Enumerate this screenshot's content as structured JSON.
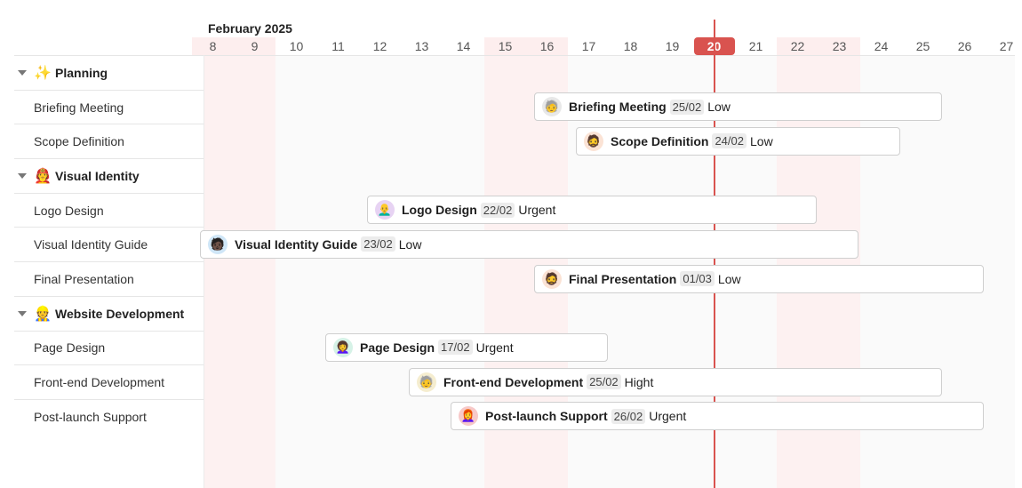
{
  "header": {
    "month": "February 2025"
  },
  "dates": [
    "8",
    "9",
    "10",
    "11",
    "12",
    "13",
    "14",
    "15",
    "16",
    "17",
    "18",
    "19",
    "20",
    "21",
    "22",
    "23",
    "24",
    "25",
    "26",
    "27"
  ],
  "weekend_days": [
    "8",
    "9",
    "15",
    "16",
    "22",
    "23"
  ],
  "today": "20",
  "colors": {
    "today": "#d9534f",
    "weekend": "#fdeeee",
    "bar_border": "#cfcfcf"
  },
  "groups": [
    {
      "label": "Planning",
      "emoji": "✨",
      "tasks": [
        {
          "name": "Briefing Meeting",
          "start": 16,
          "end": 25,
          "date": "25/02",
          "priority": "Low",
          "avatar": "🧓",
          "avatar_bg": "#e8e8e8"
        },
        {
          "name": "Scope Definition",
          "start": 17,
          "end": 24,
          "date": "24/02",
          "priority": "Low",
          "avatar": "🧔",
          "avatar_bg": "#fbe3d5"
        }
      ]
    },
    {
      "label": "Visual Identity",
      "emoji": "🧑‍🚒",
      "tasks": [
        {
          "name": "Logo Design",
          "start": 12,
          "end": 22,
          "date": "22/02",
          "priority": "Urgent",
          "avatar": "👨‍🦲",
          "avatar_bg": "#e7d3f3"
        },
        {
          "name": "Visual Identity Guide",
          "start": 8,
          "end": 23,
          "date": "23/02",
          "priority": "Low",
          "avatar": "🧑🏿",
          "avatar_bg": "#cfe6f7"
        },
        {
          "name": "Final Presentation",
          "start": 16,
          "end": 26,
          "date": "01/03",
          "priority": "Low",
          "avatar": "🧔",
          "avatar_bg": "#fbe3d5"
        }
      ]
    },
    {
      "label": "Website Development",
      "emoji": "👷",
      "tasks": [
        {
          "name": "Page Design",
          "start": 11,
          "end": 17,
          "date": "17/02",
          "priority": "Urgent",
          "avatar": "👩‍🦱",
          "avatar_bg": "#d6f2e7"
        },
        {
          "name": "Front-end Development",
          "start": 13,
          "end": 25,
          "date": "25/02",
          "priority": "Hight",
          "avatar": "🧓",
          "avatar_bg": "#f5edcf"
        },
        {
          "name": "Post-launch Support",
          "start": 14,
          "end": 26,
          "date": "26/02",
          "priority": "Urgent",
          "avatar": "👩‍🦰",
          "avatar_bg": "#f7c9c9"
        }
      ]
    }
  ]
}
